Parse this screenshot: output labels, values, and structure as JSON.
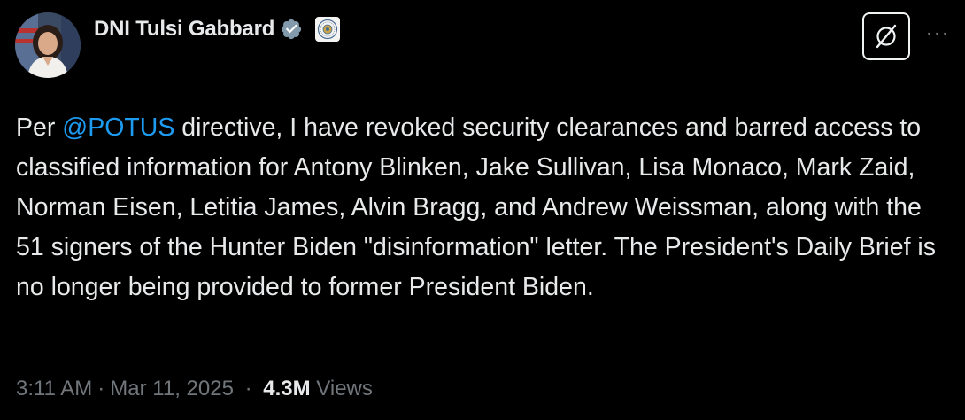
{
  "author": {
    "display_name": "DNI Tulsi Gabbard",
    "verified_badge_color": "#829aab",
    "affiliation_badge": "dni-seal-icon"
  },
  "actions": {
    "grok_icon": "grok-icon",
    "more_label": "···"
  },
  "tweet": {
    "text_before": "Per ",
    "mention": "@POTUS",
    "text_after": " directive, I have revoked security clearances and barred access to classified information for Antony Blinken, Jake Sullivan, Lisa Monaco, Mark Zaid, Norman Eisen, Letitia James, Alvin Bragg, and Andrew Weissman, along with the 51 signers of the Hunter Biden \"disinformation\" letter. The President's Daily Brief is no longer being provided to former President Biden."
  },
  "meta": {
    "time": "3:11 AM",
    "separator": "·",
    "date": "Mar 11, 2025",
    "views_count": "4.3M",
    "views_label": "Views"
  },
  "colors": {
    "background": "#000000",
    "text": "#e7e9ea",
    "secondary": "#71767b",
    "link": "#1d9bf0"
  }
}
